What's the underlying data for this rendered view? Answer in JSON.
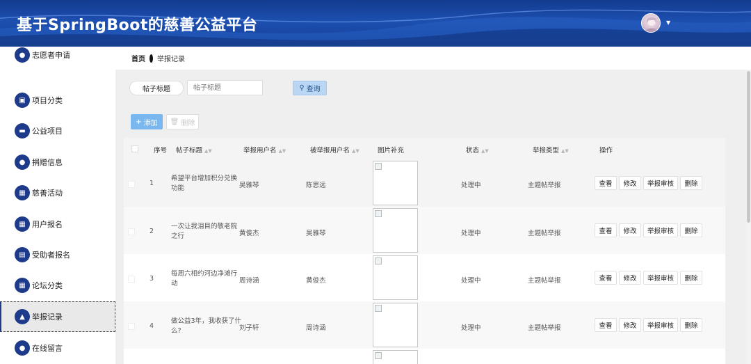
{
  "header": {
    "title": "基于SpringBoot的慈善公益平台",
    "avatar_icon": "user-avatar",
    "caret_icon": "caret-down-icon"
  },
  "sidebar": {
    "items": [
      {
        "label": "志愿者申请",
        "icon": "user-icon"
      },
      {
        "label": "项目分类",
        "icon": "briefcase-icon"
      },
      {
        "label": "公益项目",
        "icon": "chat-icon"
      },
      {
        "label": "捐赠信息",
        "icon": "location-icon"
      },
      {
        "label": "慈善活动",
        "icon": "grid-icon"
      },
      {
        "label": "用户报名",
        "icon": "grid-icon"
      },
      {
        "label": "受助者报名",
        "icon": "clipboard-icon"
      },
      {
        "label": "论坛分类",
        "icon": "grid-icon"
      },
      {
        "label": "举报记录",
        "icon": "thumb-icon",
        "active": true
      },
      {
        "label": "在线留言",
        "icon": "user-icon"
      }
    ]
  },
  "breadcrumb": {
    "home": "首页",
    "current": "举报记录"
  },
  "search": {
    "label": "帖子标题",
    "placeholder": "帖子标题",
    "query_label": "查询"
  },
  "toolbar": {
    "add_label": "添加",
    "delete_label": "删除"
  },
  "table": {
    "columns": [
      "序号",
      "帖子标题",
      "举报用户名",
      "被举报用户名",
      "图片补充",
      "状态",
      "举报类型",
      "操作"
    ],
    "rows": [
      {
        "index": "1",
        "title_line1": "希望平台增加积分兑换",
        "title_line2": "功能",
        "reporter": "吴雅琴",
        "reported": "陈思远",
        "status": "处理中",
        "type": "主题帖举报"
      },
      {
        "index": "2",
        "title_line1": "一次让我泪目的敬老院",
        "title_line2": "之行",
        "reporter": "黄俊杰",
        "reported": "吴雅琴",
        "status": "处理中",
        "type": "主题帖举报"
      },
      {
        "index": "3",
        "title_line1": "每周六相约河边净滩行",
        "title_line2": "动",
        "reporter": "周诗涵",
        "reported": "黄俊杰",
        "status": "处理中",
        "type": "主题帖举报"
      },
      {
        "index": "4",
        "title_line1": "做公益3年，我收获了什",
        "title_line2": "么?",
        "reporter": "刘子轩",
        "reported": "周诗涵",
        "status": "处理中",
        "type": "主题帖举报"
      }
    ],
    "actions": {
      "view": "查看",
      "edit": "修改",
      "review": "举报审核",
      "delete": "删除"
    }
  }
}
